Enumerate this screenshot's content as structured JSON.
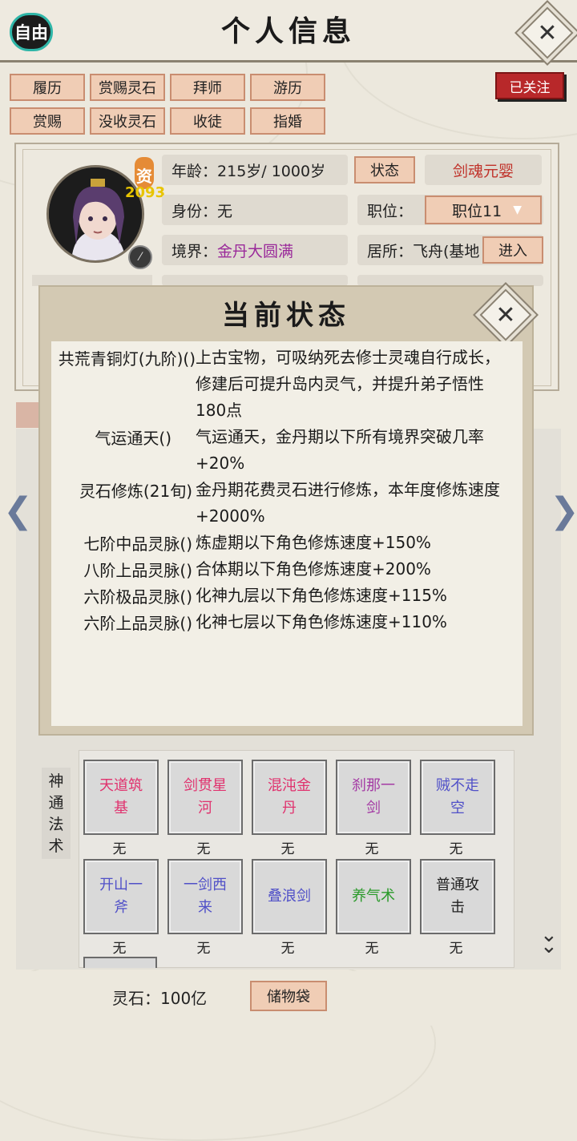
{
  "header": {
    "title": "个人信息",
    "free_label": "自由",
    "follow_label": "已关注"
  },
  "actions": {
    "row1": [
      "履历",
      "赏赐灵石",
      "拜师",
      "游历"
    ],
    "row2": [
      "赏赐",
      "没收灵石",
      "收徒",
      "指婚"
    ]
  },
  "profile": {
    "aptitude_label": "资",
    "aptitude_value": "2093",
    "age_label": "年龄：",
    "age_value": "215岁/ 1000岁",
    "status_button": "状态",
    "title_badge": "剑魂元婴",
    "identity_label": "身份：",
    "identity_value": "无",
    "position_label": "职位：",
    "position_value": "职位11",
    "realm_label": "境界：",
    "realm_value": "金丹大圆满",
    "residence_label": "居所：",
    "residence_value": "飞舟(基地",
    "enter_button": "进入"
  },
  "status_modal": {
    "title": "当前状态",
    "items": [
      {
        "name": "共荒青铜灯(九阶)()",
        "desc": "上古宝物，可吸纳死去修士灵魂自行成长，修建后可提升岛内灵气，并提升弟子悟性180点"
      },
      {
        "name": "气运通天()",
        "desc": "气运通天，金丹期以下所有境界突破几率+20%"
      },
      {
        "name": "灵石修炼(21旬)",
        "desc": "金丹期花费灵石进行修炼，本年度修炼速度+2000%"
      },
      {
        "name": "七阶中品灵脉()",
        "desc": "炼虚期以下角色修炼速度+150%"
      },
      {
        "name": "八阶上品灵脉()",
        "desc": "合体期以下角色修炼速度+200%"
      },
      {
        "name": "六阶极品灵脉()",
        "desc": "化神九层以下角色修炼速度+115%"
      },
      {
        "name": "六阶上品灵脉()",
        "desc": "化神七层以下角色修炼速度+110%"
      }
    ]
  },
  "skills": {
    "section_label": "神通法术",
    "items": [
      {
        "name": "天道筑基",
        "level": "无",
        "color": "#e0326e"
      },
      {
        "name": "剑贯星河",
        "level": "无",
        "color": "#e0326e"
      },
      {
        "name": "混沌金丹",
        "level": "无",
        "color": "#e0326e"
      },
      {
        "name": "刹那一剑",
        "level": "无",
        "color": "#a43aa4"
      },
      {
        "name": "贼不走空",
        "level": "无",
        "color": "#5050c8"
      },
      {
        "name": "开山一斧",
        "level": "无",
        "color": "#5050c8"
      },
      {
        "name": "一剑西来",
        "level": "无",
        "color": "#5050c8"
      },
      {
        "name": "叠浪剑",
        "level": "无",
        "color": "#5050c8"
      },
      {
        "name": "养气术",
        "level": "无",
        "color": "#2a9a2a"
      },
      {
        "name": "普通攻击",
        "level": "无",
        "color": "#222222"
      }
    ]
  },
  "footer": {
    "spirit_stones": "灵石：100亿",
    "bag_button": "储物袋"
  }
}
